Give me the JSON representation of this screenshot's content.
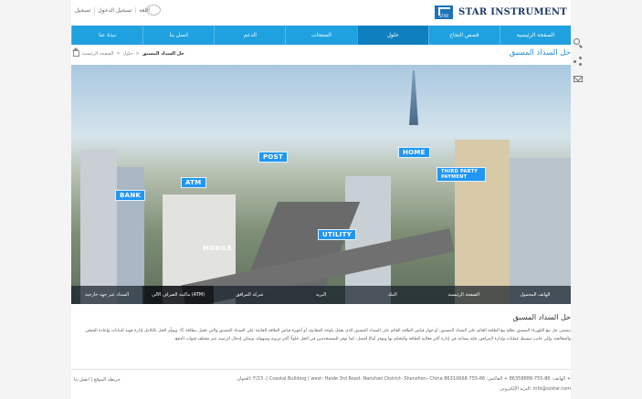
{
  "header": {
    "top_links": [
      "تسجيل",
      "تسجيل الدخول",
      "اللغة"
    ],
    "logo_mark": "STAR",
    "logo_text": "STAR INSTRUMENT"
  },
  "nav": {
    "items": [
      "الصفحة الرئيسية",
      "قصص النجاح",
      "حلول",
      "المنتجات",
      "الدعم",
      "اتصل بنا",
      "نبذة عنا"
    ],
    "active_index": 2
  },
  "page": {
    "title": "حل السداد المسبق",
    "breadcrumb": [
      "الصفحة الرئيسية",
      "حلول",
      "حل السداد المسبق"
    ]
  },
  "hero": {
    "signs": [
      "BANK",
      "ATM",
      "POST",
      "UTILITY",
      "THIRD PARTY PAYMENT",
      "HOME",
      "MOBILE"
    ],
    "tabs": [
      "الهاتف المحمول",
      "الصفحة الرئيسية",
      "البنك",
      "البريد",
      "شركة المرافق",
      "ماكينة الصراف الآلي (ATM)",
      "السداد عبر جهة خارجية"
    ],
    "active_tab": 5
  },
  "content": {
    "heading": "حل السداد المسبق",
    "paragraph": "يتضمن حل بيع الكهرباء المسبق نظام بيع الطاقة القائم على السداد المسبق، أو جهاز قياس الطاقة القائم على السداد المسبق الذي يعمل بلوحة المفاتيح، أو أجهزة قياس الطاقة القائمة على السداد المسبق والتي تعمل ببطاقة IC. ويوفّر الحل بالكامل إدارة قوية للبيانات وإعادة الشحن والمعالجة، وإلى جانب تبسيط عمليات وإدارة المرافق، فإنه يساعد في إدارة أكثر فعالية للطاقة والتحكم بها ويوفر أمانًا أفضل، كما يوفر للمستخدمين في الحل حلولًا أكثر مرونة وسهولة، ويمكن إدخال الرصيد عبر مختلف قنوات الدفع."
  },
  "footer": {
    "links": "خريطة الموقع | اتصل بنا",
    "address": "العنوان: F/23 ,( Coastal Building ( west- Haide 3rd Road- Nanshan District- Shenzhen- China   الهاتف: 86-755-86358888 +   الفاكس: 86-755-86310668 +",
    "email": "البريد الإلكتروني: info@szstar.com"
  },
  "side_tools": [
    "search-icon",
    "share-icon",
    "mail-icon"
  ],
  "colors": {
    "accent": "#1fa1e0",
    "nav_active": "#0f7fc0",
    "title": "#1f8fd4"
  }
}
